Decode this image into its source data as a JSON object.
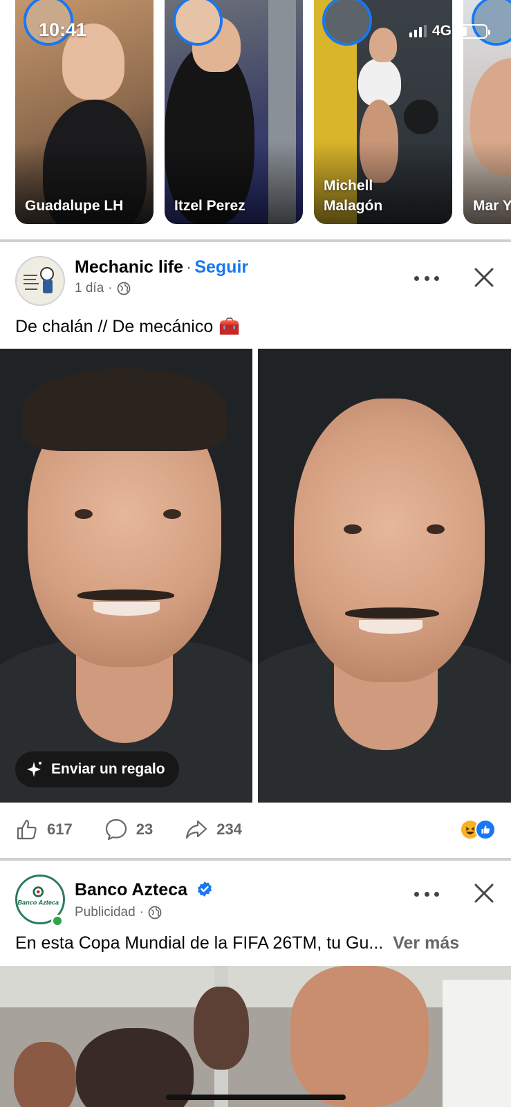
{
  "status_bar": {
    "time": "10:41",
    "network": "4G",
    "battery_level": 0.3,
    "signal_bars": 3
  },
  "stories": [
    {
      "name": "Guadalupe LH",
      "bg": "#9c7a5d"
    },
    {
      "name": "Itzel Perez",
      "bg": "#5a5d63"
    },
    {
      "name": "Michell\nMalagón",
      "bg": "#3d4348"
    },
    {
      "name": "Mar Y",
      "bg": "#c9cfd6"
    }
  ],
  "posts": [
    {
      "page_name": "Mechanic life",
      "follow_label": "Seguir",
      "time": "1 día",
      "privacy_icon": "globe-icon",
      "text": "De chalán // De mecánico",
      "text_emoji": "🧰",
      "gift_label": "Enviar un regalo",
      "reactions": [
        "haha",
        "like"
      ],
      "likes": "617",
      "comments": "23",
      "shares": "234"
    },
    {
      "page_name": "Banco Azteca",
      "verified": true,
      "meta": "Publicidad",
      "privacy_icon": "globe-icon",
      "text": "En esta Copa Mundial de la FIFA 26TM, tu Gu...",
      "see_more": "Ver más",
      "avatar_text": "Banco Azteca"
    }
  ],
  "colors": {
    "accent": "#1877f2",
    "secondary_text": "#65676b",
    "divider": "#ced0d4",
    "online": "#31a24c"
  }
}
